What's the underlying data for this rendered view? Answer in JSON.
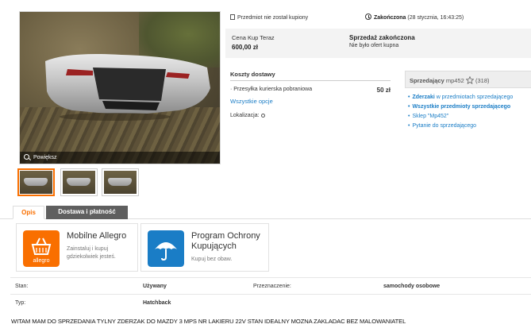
{
  "gallery": {
    "zoom_label": "Powiększ",
    "thumbnails": 3
  },
  "status": {
    "not_bought": "Przedmiot nie został kupiony",
    "ended_label": "Zakończona",
    "ended_date": "(28 stycznia, 16:43:25)"
  },
  "price": {
    "label": "Cena Kup Teraz",
    "value": "600,00 zł",
    "sale_status": "Sprzedaż zakończona",
    "sale_sub": "Nie było ofert kupna"
  },
  "shipping": {
    "title": "Koszty dostawy",
    "option_label": "Przesyłka kurierska pobraniowa",
    "option_price": "50 zł",
    "all_options": "Wszystkie opcje",
    "location_label": "Lokalizacja:"
  },
  "seller": {
    "label": "Sprzedający",
    "name": "mp452",
    "rating": "(318)",
    "links": [
      {
        "bold": "Zderzaki",
        "rest": " w przedmiotach sprzedającego"
      },
      {
        "bold": "Wszystkie przedmioty sprzedającego",
        "rest": ""
      },
      {
        "bold": "",
        "rest": "Sklep \"Mp452\""
      },
      {
        "bold": "",
        "rest": "Pytanie do sprzedającego"
      }
    ]
  },
  "tabs": [
    {
      "label": "Opis"
    },
    {
      "label": "Dostawa i płatność"
    }
  ],
  "promos": [
    {
      "title": "Mobilne Allegro",
      "subtitle_1": "Zainstaluj i kupuj",
      "subtitle_2": "gdziekolwiek jesteś.",
      "logo_text": "allegro"
    },
    {
      "title_1": "Program Ochrony",
      "title_2": "Kupujących",
      "subtitle": "Kupuj bez obaw."
    }
  ],
  "attributes": [
    {
      "label": "Stan:",
      "value": "Używany",
      "label2": "Przeznaczenie:",
      "value2": "samochody osobowe"
    },
    {
      "label": "Typ:",
      "value": "Hatchback"
    }
  ],
  "description": "WITAM MAM DO SPRZEDANIA TYLNY ZDERZAK DO MAZDY 3 MPS NR LAKIERU 22V STAN IDEALNY MOZNA ZAKLADAC BEZ MALOWANIATEL",
  "colors": {
    "accent": "#f96f00",
    "link": "#1a7dc6",
    "tab_dark": "#5f5f5f"
  }
}
